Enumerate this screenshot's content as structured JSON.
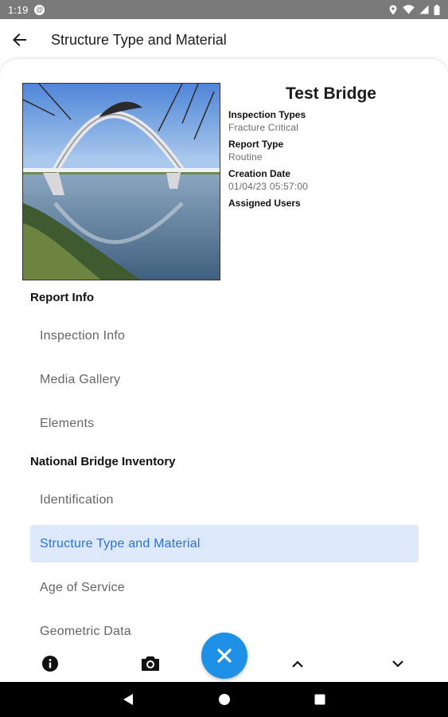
{
  "status_bar": {
    "time": "1:19"
  },
  "app_bar": {
    "title": "Structure Type and Material"
  },
  "structure": {
    "name": "Test Bridge",
    "fields": [
      {
        "label": "Inspection Types",
        "value": "Fracture Critical"
      },
      {
        "label": "Report Type",
        "value": "Routine"
      },
      {
        "label": "Creation Date",
        "value": "01/04/23 05:57:00"
      },
      {
        "label": "Assigned Users",
        "value": ""
      }
    ]
  },
  "sections": {
    "report_info": {
      "header": "Report Info",
      "items": [
        "Inspection Info",
        "Media Gallery",
        "Elements"
      ]
    },
    "nbi": {
      "header": "National Bridge Inventory",
      "items": [
        "Identification",
        "Structure Type and Material",
        "Age of Service",
        "Geometric Data"
      ]
    }
  },
  "active_item": "Structure Type and Material",
  "colors": {
    "accent": "#1e90e6",
    "active_bg": "#dde9fa",
    "active_text": "#2a72d5",
    "status_bar": "#7a7a7a"
  },
  "bottom_bar": {
    "icons": [
      "info-icon",
      "camera-icon",
      "close-icon",
      "chevron-up-icon",
      "chevron-down-icon"
    ]
  }
}
